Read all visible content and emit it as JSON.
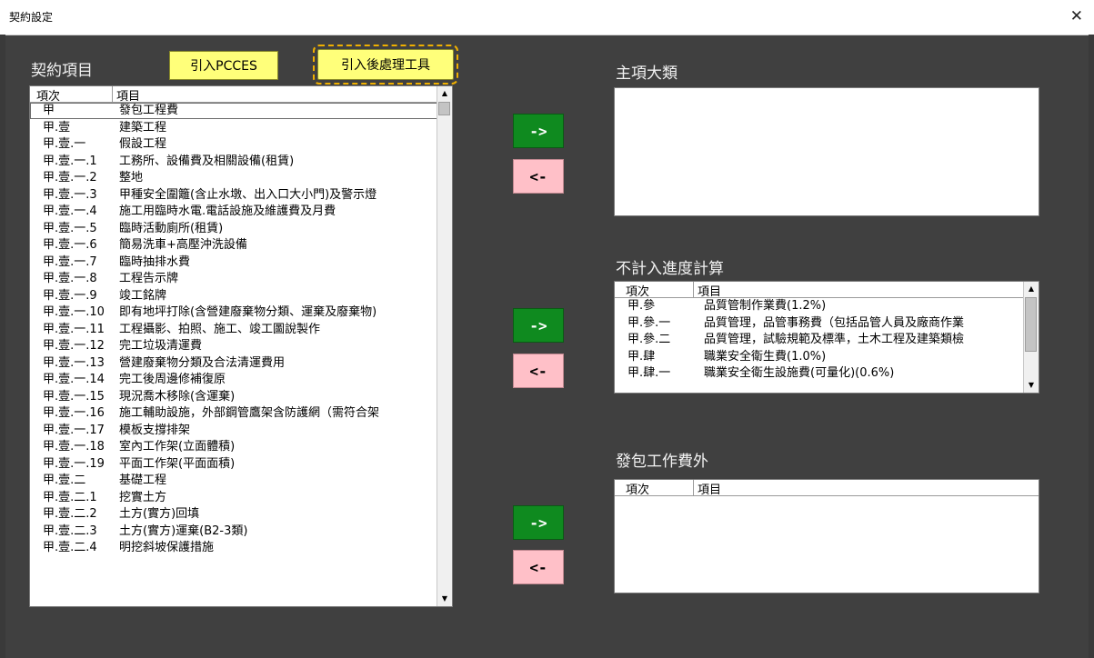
{
  "window": {
    "title": "契約設定",
    "close_glyph": "✕"
  },
  "left_panel": {
    "label": "契約項目",
    "import_pcces_label": "引入PCCES",
    "import_post_label": "引入後處理工具",
    "columns": [
      "項次",
      "項目"
    ],
    "rows": [
      [
        "甲",
        "發包工程費"
      ],
      [
        "甲.壹",
        "建築工程"
      ],
      [
        "甲.壹.一",
        "假設工程"
      ],
      [
        "甲.壹.一.1",
        "工務所、設備費及相關設備(租賃)"
      ],
      [
        "甲.壹.一.2",
        "整地"
      ],
      [
        "甲.壹.一.3",
        "甲種安全圍籬(含止水墩、出入口大小門)及警示燈"
      ],
      [
        "甲.壹.一.4",
        "施工用臨時水電.電話設施及維護費及月費"
      ],
      [
        "甲.壹.一.5",
        "臨時活動廁所(租賃)"
      ],
      [
        "甲.壹.一.6",
        "簡易洗車+高壓沖洗設備"
      ],
      [
        "甲.壹.一.7",
        "臨時抽排水費"
      ],
      [
        "甲.壹.一.8",
        "工程告示牌"
      ],
      [
        "甲.壹.一.9",
        "竣工銘牌"
      ],
      [
        "甲.壹.一.10",
        "即有地坪打除(含營建廢棄物分類、運棄及廢棄物)"
      ],
      [
        "甲.壹.一.11",
        "工程攝影、拍照、施工、竣工圖說製作"
      ],
      [
        "甲.壹.一.12",
        "完工垃圾清運費"
      ],
      [
        "甲.壹.一.13",
        "營建廢棄物分類及合法清運費用"
      ],
      [
        "甲.壹.一.14",
        "完工後周邊修補復原"
      ],
      [
        "甲.壹.一.15",
        "現況喬木移除(含運棄)"
      ],
      [
        "甲.壹.一.16",
        "施工輔助設施，外部鋼管鷹架含防護網（需符合架"
      ],
      [
        "甲.壹.一.17",
        "模板支撐排架"
      ],
      [
        "甲.壹.一.18",
        "室內工作架(立面體積)"
      ],
      [
        "甲.壹.一.19",
        "平面工作架(平面面積)"
      ],
      [
        "甲.壹.二",
        "基礎工程"
      ],
      [
        "甲.壹.二.1",
        "挖實土方"
      ],
      [
        "甲.壹.二.2",
        "土方(實方)回填"
      ],
      [
        "甲.壹.二.3",
        "土方(實方)運棄(B2-3類)"
      ],
      [
        "甲.壹.二.4",
        "明挖斜坡保護措施"
      ]
    ]
  },
  "arrows": {
    "right": "->",
    "left": "<-"
  },
  "main_category": {
    "label": "主項大類"
  },
  "progress_excluded": {
    "label": "不計入進度計算",
    "columns": [
      "項次",
      "項目"
    ],
    "rows": [
      [
        "甲.參",
        "品質管制作業費(1.2%)"
      ],
      [
        "甲.參.一",
        "品質管理，品管事務費（包括品管人員及廠商作業"
      ],
      [
        "甲.參.二",
        "品質管理，試驗規範及標準，土木工程及建築類檢"
      ],
      [
        "甲.肆",
        "職業安全衛生費(1.0%)"
      ],
      [
        "甲.肆.一",
        "職業安全衛生設施費(可量化)(0.6%)"
      ]
    ]
  },
  "outside_contract": {
    "label": "發包工作費外",
    "columns": [
      "項次",
      "項目"
    ],
    "rows": []
  },
  "colors": {
    "background": "#404040",
    "yellow_button": "#ffff7a",
    "green_button": "#0f8a1f",
    "pink_button": "#ffc0c8"
  }
}
